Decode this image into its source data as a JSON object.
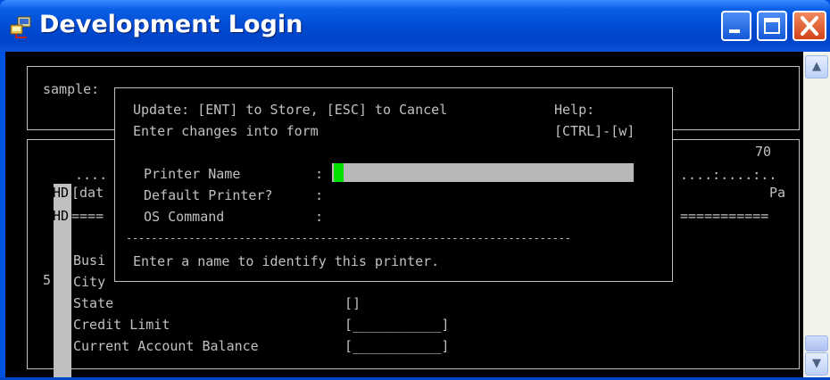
{
  "window": {
    "title": "Development Login",
    "icon": "network-connection-icon",
    "controls": {
      "minimize": "minimize-icon",
      "maximize": "maximize-icon",
      "close": "close-icon"
    }
  },
  "background_form": {
    "top_label": "sample:",
    "column_number": "70",
    "ruler_left": "....",
    "ruler_right": "....:....:..",
    "hd_label_1": "HD",
    "hd_text_1": "[dat",
    "hd_right_1": "Pa",
    "hd_label_2": "HD",
    "hd_text_2": "====",
    "hd_right_2": "===========",
    "row_busi": "Busi",
    "row_5": "5",
    "row_city": "City",
    "fields": [
      {
        "label": "State",
        "value": "[]"
      },
      {
        "label": "Credit Limit",
        "value": "[___________]"
      },
      {
        "label": "Current Account Balance",
        "value": "[___________]"
      }
    ]
  },
  "dialog": {
    "instructions_line1": "Update: [ENT] to Store, [ESC] to Cancel",
    "instructions_line2": "Enter changes into form",
    "help_label": "Help:",
    "help_key": "[CTRL]-[w]",
    "fields": [
      {
        "label": "Printer Name",
        "colon": ":"
      },
      {
        "label": "Default Printer?",
        "colon": ":"
      },
      {
        "label": "OS Command",
        "colon": ":"
      }
    ],
    "separator": "-----------------------------------------------------------------------",
    "hint": "Enter a name to identify this printer."
  },
  "scrollbar": {
    "up": "▲",
    "down": "▼"
  }
}
